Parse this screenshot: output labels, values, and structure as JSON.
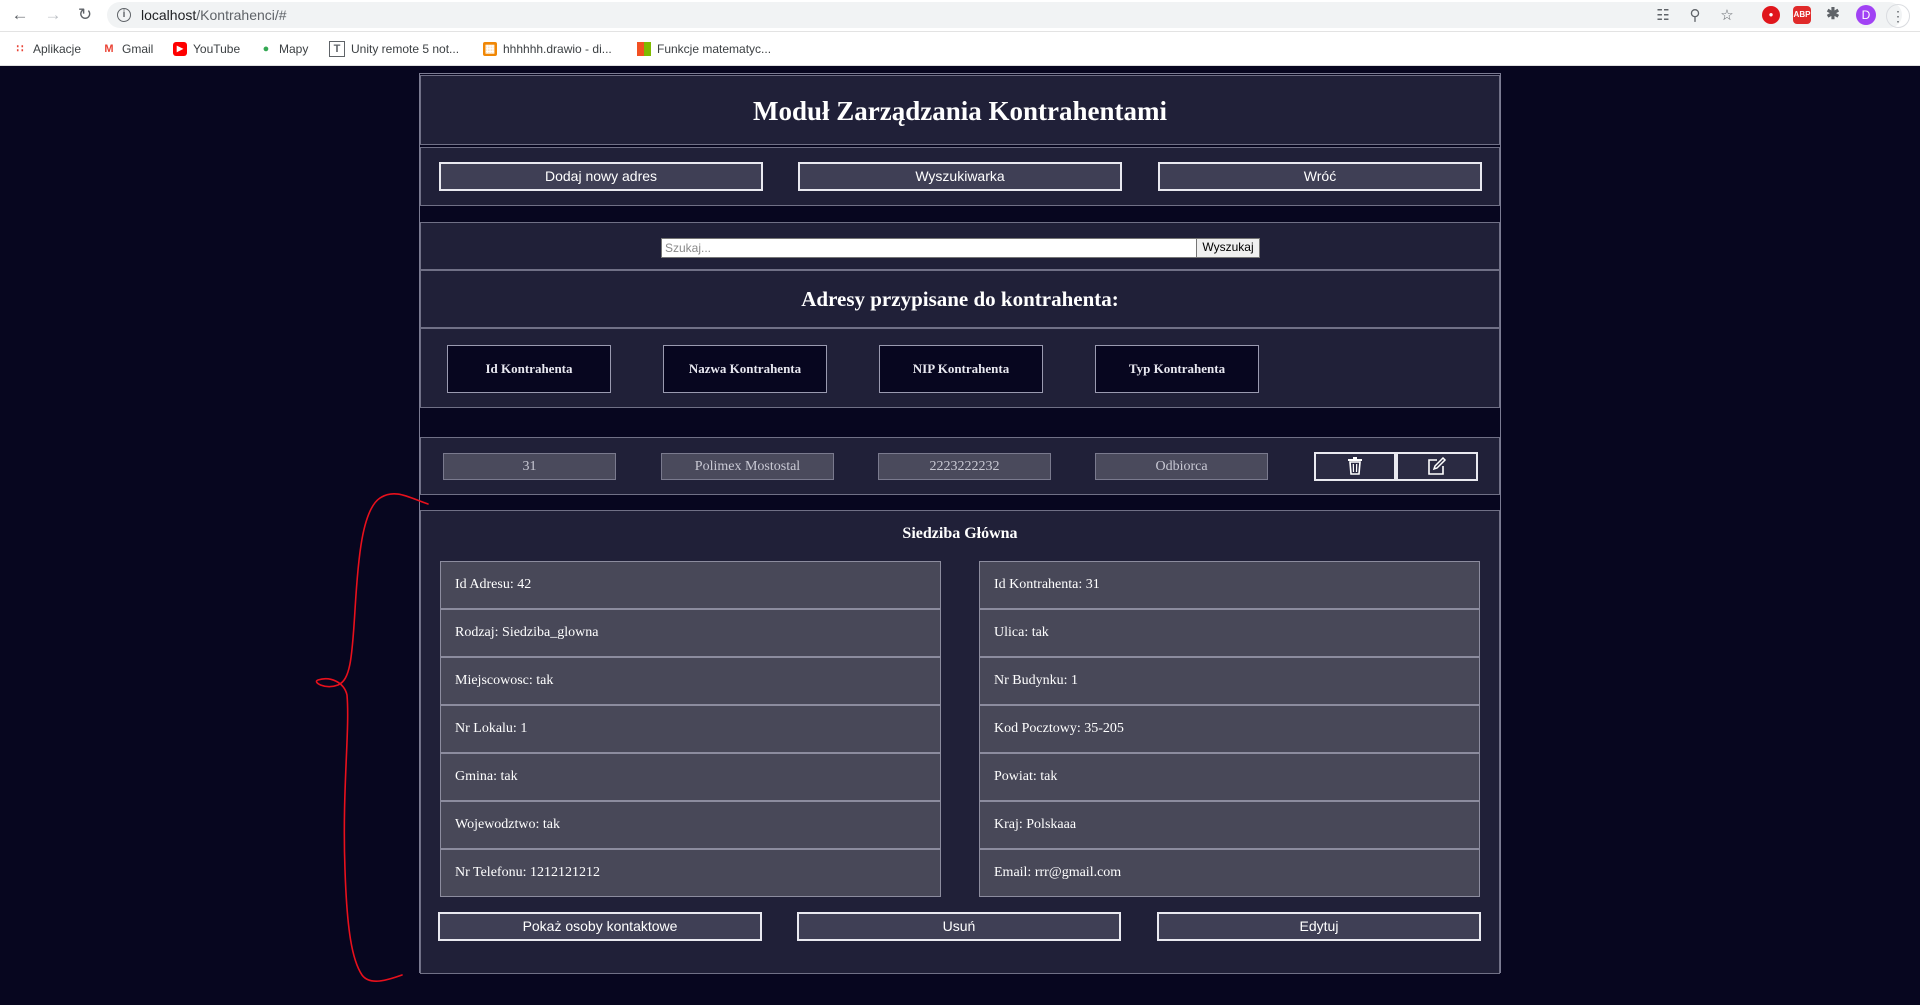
{
  "browser": {
    "url_host": "localhost",
    "url_path": "/Kontrahenci/#",
    "avatar_letter": "D",
    "bookmarks": [
      {
        "label": "Aplikacje",
        "icon": "apps-grid-icon",
        "color": "#e94235"
      },
      {
        "label": "Gmail",
        "icon": "gmail-icon",
        "color": "#ea4335"
      },
      {
        "label": "YouTube",
        "icon": "youtube-icon",
        "color": "#ff0000"
      },
      {
        "label": "Mapy",
        "icon": "maps-pin-icon",
        "color": "#34a853"
      },
      {
        "label": "Unity remote 5 not...",
        "icon": "unity-icon",
        "color": "#5f6368"
      },
      {
        "label": "hhhhhh.drawio - di...",
        "icon": "drawio-icon",
        "color": "#f08705"
      },
      {
        "label": "Funkcje matematyc...",
        "icon": "microsoft-icon",
        "color": "#f25022"
      }
    ]
  },
  "page": {
    "title": "Moduł Zarządzania Kontrahentami",
    "nav_buttons": {
      "add": "Dodaj nowy adres",
      "search": "Wyszukiwarka",
      "back": "Wróć"
    },
    "search": {
      "placeholder": "Szukaj...",
      "value": "",
      "button": "Wyszukaj"
    },
    "subtitle": "Adresy przypisane do kontrahenta:",
    "table_headers": [
      "Id Kontrahenta",
      "Nazwa Kontrahenta",
      "NIP Kontrahenta",
      "Typ Kontrahenta"
    ],
    "contractor_row": {
      "id": "31",
      "name": "Polimex Mostostal",
      "nip": "2223222232",
      "type": "Odbiorca"
    },
    "address": {
      "heading": "Siedziba Główna",
      "left_fields": [
        "Id Adresu: 42",
        "Rodzaj: Siedziba_glowna",
        "Miejscowosc: tak",
        "Nr Lokalu: 1",
        "Gmina: tak",
        "Wojewodztwo: tak",
        "Nr Telefonu: 1212121212"
      ],
      "right_fields": [
        "Id Kontrahenta: 31",
        "Ulica: tak",
        "Nr Budynku: 1",
        "Kod Pocztowy: 35-205",
        "Powiat: tak",
        "Kraj: Polskaaa",
        "Email: rrr@gmail.com"
      ],
      "buttons": {
        "contacts": "Pokaż osoby kontaktowe",
        "delete": "Usuń",
        "edit": "Edytuj"
      }
    }
  },
  "colors": {
    "page_bg": "#07061f",
    "section_bg": "#202038",
    "field_bg": "#484858",
    "annotation": "#e8101c"
  }
}
